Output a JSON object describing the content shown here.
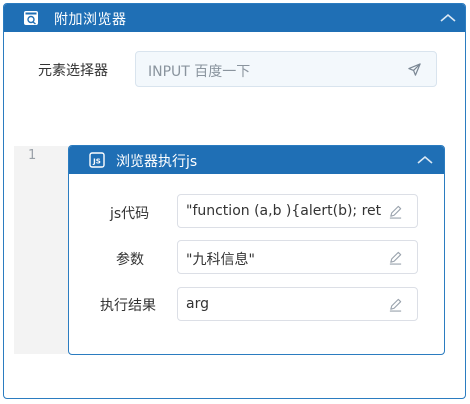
{
  "panel": {
    "title": "附加浏览器",
    "header_color": "#1f6fb5",
    "icon": "browser-icon",
    "collapse_icon": "chevron-up-icon"
  },
  "selector": {
    "label": "元素选择器",
    "value": "INPUT 百度一下",
    "icon": "send-icon"
  },
  "step_number": "1",
  "sub_panel": {
    "title": "浏览器执行js",
    "icon": "js-icon",
    "collapse_icon": "chevron-up-icon",
    "fields": [
      {
        "label": "js代码",
        "value": "\"function (a,b ){alert(b); return",
        "icon": "edit-icon"
      },
      {
        "label": "参数",
        "value": "\"九科信息\"",
        "icon": "edit-icon"
      },
      {
        "label": "执行结果",
        "value": "arg",
        "icon": "edit-icon"
      }
    ]
  }
}
